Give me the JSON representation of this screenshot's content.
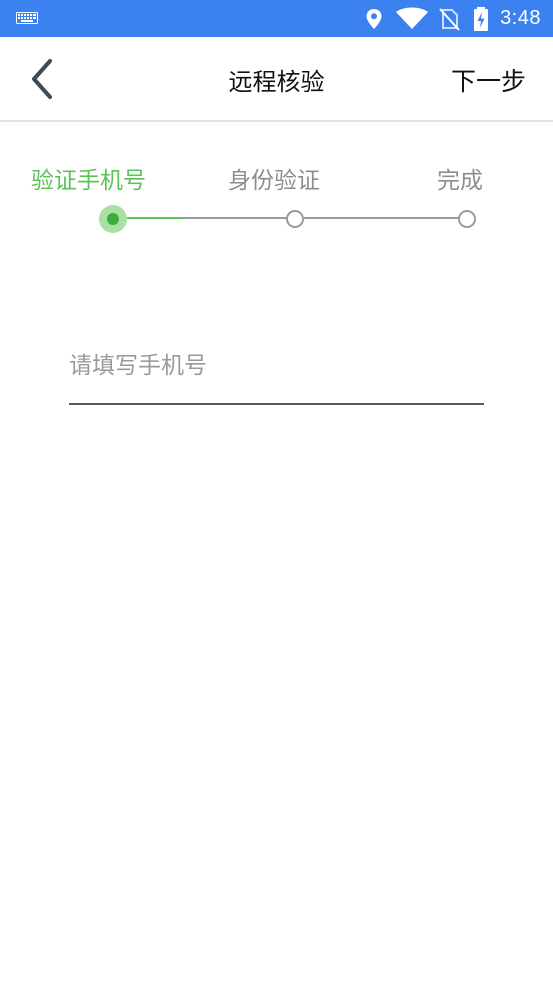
{
  "status_bar": {
    "time": "3:48",
    "background": "#3b82f0",
    "icons": [
      "keyboard-icon",
      "location-icon",
      "wifi-icon",
      "no-sim-icon",
      "battery-charging-icon"
    ]
  },
  "app_bar": {
    "title": "远程核验",
    "next_label": "下一步",
    "back_icon": "chevron-left-icon"
  },
  "steps": {
    "items": [
      {
        "label": "验证手机号",
        "state": "active"
      },
      {
        "label": "身份验证",
        "state": "pending"
      },
      {
        "label": "完成",
        "state": "pending"
      }
    ],
    "active_color": "#5cc456",
    "pending_color": "#8d8d8d"
  },
  "phone": {
    "placeholder": "请填写手机号",
    "value": ""
  }
}
